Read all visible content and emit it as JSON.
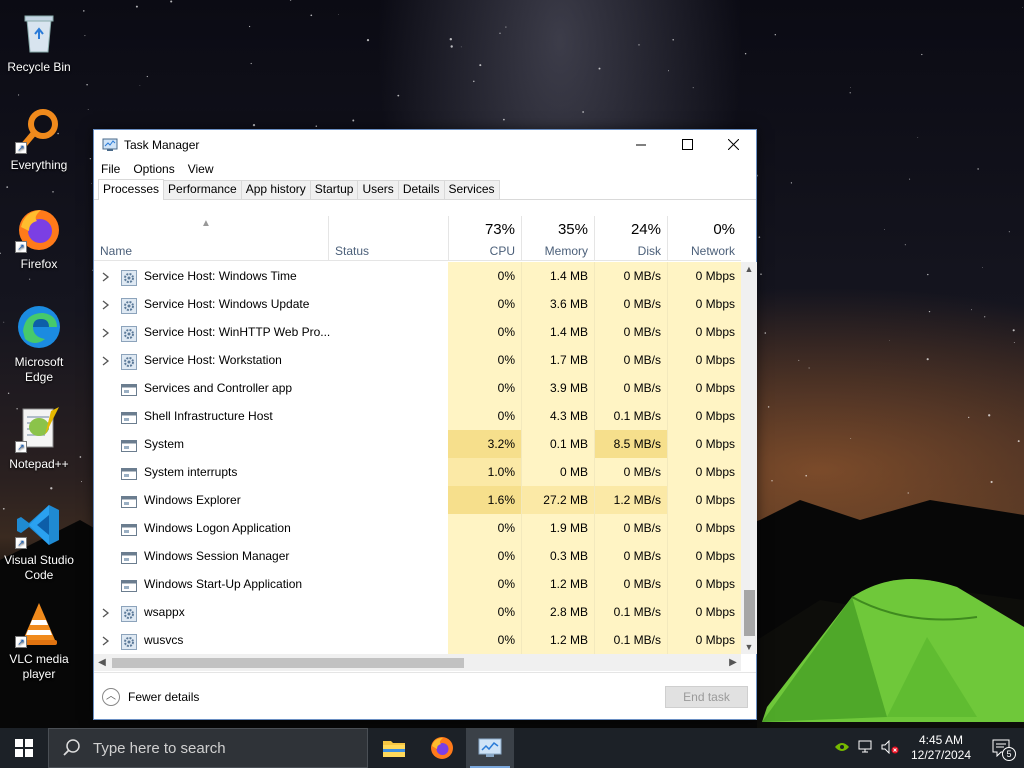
{
  "desktop": {
    "icons": [
      {
        "label": "Recycle Bin",
        "icon": "recycle-bin-icon"
      },
      {
        "label": "Everything",
        "icon": "everything-search-icon"
      },
      {
        "label": "Firefox",
        "icon": "firefox-icon"
      },
      {
        "label": "Microsoft Edge",
        "icon": "edge-icon"
      },
      {
        "label": "Notepad++",
        "icon": "notepadpp-icon"
      },
      {
        "label": "Visual Studio Code",
        "icon": "vscode-icon"
      },
      {
        "label": "VLC media player",
        "icon": "vlc-icon"
      }
    ]
  },
  "window": {
    "title": "Task Manager",
    "menu": [
      "File",
      "Options",
      "View"
    ],
    "tabs": [
      "Processes",
      "Performance",
      "App history",
      "Startup",
      "Users",
      "Details",
      "Services"
    ],
    "active_tab": "Processes",
    "columns": {
      "name": "Name",
      "status": "Status",
      "cpu": {
        "pct": "73%",
        "label": "CPU"
      },
      "memory": {
        "pct": "35%",
        "label": "Memory"
      },
      "disk": {
        "pct": "24%",
        "label": "Disk"
      },
      "network": {
        "pct": "0%",
        "label": "Network"
      }
    },
    "rows": [
      {
        "expandable": true,
        "icon": "gear-service-icon",
        "name": "Service Host: Windows Time",
        "status": "",
        "cpu": "0%",
        "memory": "1.4 MB",
        "disk": "0 MB/s",
        "network": "0 Mbps"
      },
      {
        "expandable": true,
        "icon": "gear-service-icon",
        "name": "Service Host: Windows Update",
        "status": "",
        "cpu": "0%",
        "memory": "3.6 MB",
        "disk": "0 MB/s",
        "network": "0 Mbps"
      },
      {
        "expandable": true,
        "icon": "gear-service-icon",
        "name": "Service Host: WinHTTP Web Pro...",
        "status": "",
        "cpu": "0%",
        "memory": "1.4 MB",
        "disk": "0 MB/s",
        "network": "0 Mbps"
      },
      {
        "expandable": true,
        "icon": "gear-service-icon",
        "name": "Service Host: Workstation",
        "status": "",
        "cpu": "0%",
        "memory": "1.7 MB",
        "disk": "0 MB/s",
        "network": "0 Mbps"
      },
      {
        "expandable": false,
        "icon": "process-window-icon",
        "name": "Services and Controller app",
        "status": "",
        "cpu": "0%",
        "memory": "3.9 MB",
        "disk": "0 MB/s",
        "network": "0 Mbps"
      },
      {
        "expandable": false,
        "icon": "process-window-icon",
        "name": "Shell Infrastructure Host",
        "status": "",
        "cpu": "0%",
        "memory": "4.3 MB",
        "disk": "0.1 MB/s",
        "network": "0 Mbps"
      },
      {
        "expandable": false,
        "icon": "process-window-icon",
        "name": "System",
        "status": "",
        "cpu": "3.2%",
        "memory": "0.1 MB",
        "disk": "8.5 MB/s",
        "network": "0 Mbps"
      },
      {
        "expandable": false,
        "icon": "process-window-icon",
        "name": "System interrupts",
        "status": "",
        "cpu": "1.0%",
        "memory": "0 MB",
        "disk": "0 MB/s",
        "network": "0 Mbps"
      },
      {
        "expandable": false,
        "icon": "process-window-icon",
        "name": "Windows Explorer",
        "status": "",
        "cpu": "1.6%",
        "memory": "27.2 MB",
        "disk": "1.2 MB/s",
        "network": "0 Mbps"
      },
      {
        "expandable": false,
        "icon": "process-window-icon",
        "name": "Windows Logon Application",
        "status": "",
        "cpu": "0%",
        "memory": "1.9 MB",
        "disk": "0 MB/s",
        "network": "0 Mbps"
      },
      {
        "expandable": false,
        "icon": "process-window-icon",
        "name": "Windows Session Manager",
        "status": "",
        "cpu": "0%",
        "memory": "0.3 MB",
        "disk": "0 MB/s",
        "network": "0 Mbps"
      },
      {
        "expandable": false,
        "icon": "process-window-icon",
        "name": "Windows Start-Up Application",
        "status": "",
        "cpu": "0%",
        "memory": "1.2 MB",
        "disk": "0 MB/s",
        "network": "0 Mbps"
      },
      {
        "expandable": true,
        "icon": "gear-service-icon",
        "name": "wsappx",
        "status": "",
        "cpu": "0%",
        "memory": "2.8 MB",
        "disk": "0.1 MB/s",
        "network": "0 Mbps"
      },
      {
        "expandable": true,
        "icon": "gear-service-icon",
        "name": "wusvcs",
        "status": "",
        "cpu": "0%",
        "memory": "1.2 MB",
        "disk": "0.1 MB/s",
        "network": "0 Mbps"
      }
    ],
    "footer": {
      "fewer_details": "Fewer details",
      "end_task": "End task"
    }
  },
  "taskbar": {
    "search_placeholder": "Type here to search",
    "apps": [
      {
        "name": "file-explorer",
        "running": false,
        "active": false
      },
      {
        "name": "firefox",
        "running": false,
        "active": false
      },
      {
        "name": "task-manager",
        "running": true,
        "active": true
      }
    ],
    "clock_time": "4:45 AM",
    "clock_date": "12/27/2024",
    "notifications_count": "5"
  }
}
